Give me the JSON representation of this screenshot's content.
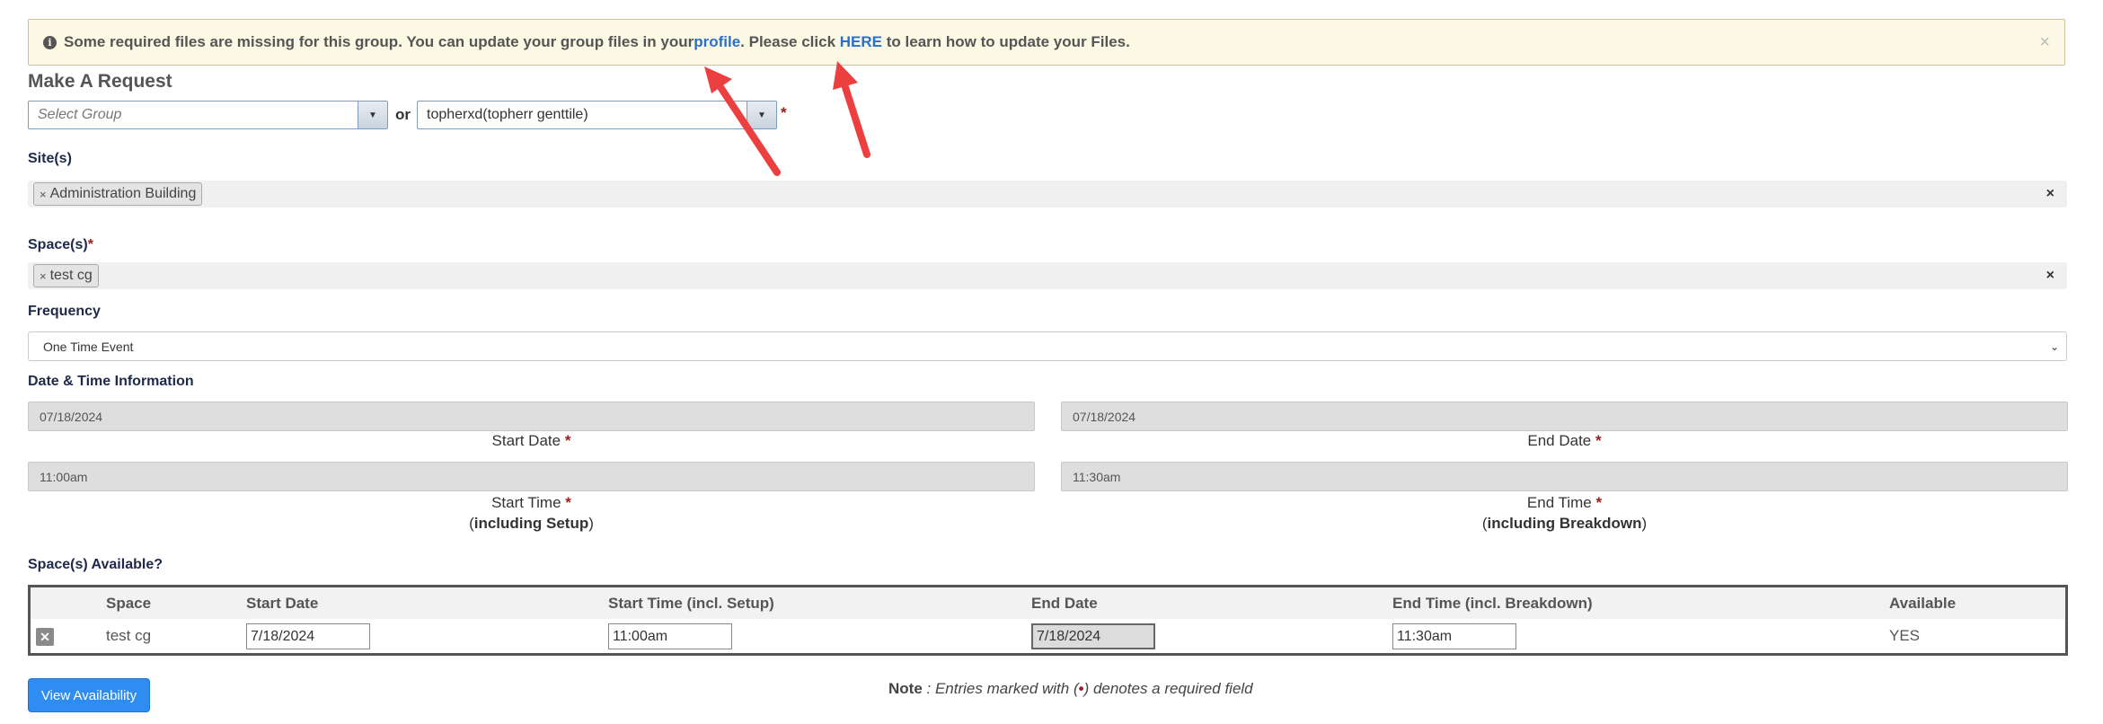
{
  "alert": {
    "icon": "info-circle-icon",
    "text_before": "Some required files are missing for this group. You can update your group files in your ",
    "link_profile": "profile",
    "text_middle": ". Please click ",
    "link_here": "HERE",
    "text_after": " to learn how to update your Files.",
    "close": "×"
  },
  "form": {
    "title": "Make A Request",
    "group_placeholder": "Select Group",
    "or_label": "or",
    "user_value": "topherxd(topherr genttile)",
    "required_mark": "*",
    "sites_label": "Site(s)",
    "sites": [
      "Administration Building"
    ],
    "spaces_label": "Space(s)",
    "spaces": [
      "test cg"
    ],
    "tag_remove": "×",
    "clear": "×",
    "frequency_label": "Frequency",
    "frequency_value": "One Time Event",
    "datetime_label": "Date & Time Information",
    "start_date": "07/18/2024",
    "end_date": "07/18/2024",
    "start_date_label": "Start Date",
    "end_date_label": "End Date",
    "start_time": "11:00am",
    "end_time": "11:30am",
    "start_time_label": "Start Time",
    "end_time_label": "End Time",
    "start_time_sub_open": "(",
    "start_time_sub": "including Setup",
    "start_time_sub_close": ")",
    "end_time_sub_open": "(",
    "end_time_sub": "including Breakdown",
    "end_time_sub_close": ")"
  },
  "availability": {
    "label": "Space(s) Available?",
    "columns": [
      "Space",
      "Start Date",
      "Start Time (incl. Setup)",
      "End Date",
      "End Time (incl. Breakdown)",
      "Available"
    ],
    "rows": [
      {
        "space": "test cg",
        "start_date": "7/18/2024",
        "start_time": "11:00am",
        "end_date": "7/18/2024",
        "end_time": "11:30am",
        "available": "YES"
      }
    ]
  },
  "footer": {
    "button": "View Availability",
    "note_label": "Note",
    "note_text_before": " : Entries marked with (",
    "note_dot": "•",
    "note_text_after": ") denotes a required field"
  },
  "colors": {
    "accent": "#2f8cf0",
    "arrow": "#ec4040",
    "required": "#9b1c1c",
    "alert_bg": "#fbf8e3"
  }
}
